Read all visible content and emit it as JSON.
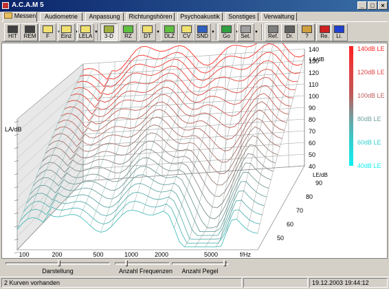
{
  "window": {
    "title": "A.C.A.M 5",
    "min": "_",
    "max": "□",
    "close": "×"
  },
  "tabs": [
    {
      "label": "Messen",
      "active": true
    },
    {
      "label": "Audiometrie"
    },
    {
      "label": "Anpassung"
    },
    {
      "label": "Richtungshören"
    },
    {
      "label": "Psychoakustik"
    },
    {
      "label": "Sonstiges"
    },
    {
      "label": "Verwaltung"
    }
  ],
  "toolbar": [
    {
      "label": "HIT",
      "icon": "hit-icon",
      "color": "#404040"
    },
    {
      "label": "REM",
      "icon": "rem-icon",
      "color": "#404040"
    },
    {
      "label": "F",
      "icon": "curve-icon",
      "color": "#f0e070"
    },
    {
      "label": "Einz",
      "icon": "curve-icon",
      "color": "#f0e070"
    },
    {
      "label": "LELA",
      "icon": "curve-icon",
      "color": "#f0e070"
    },
    {
      "label": "3-D",
      "icon": "3d-icon",
      "color": "#a0b040",
      "pressed": true
    },
    {
      "label": "RZ",
      "icon": "rz-icon",
      "color": "#60c040"
    },
    {
      "label": "DT",
      "icon": "dt-icon",
      "color": "#f0e070"
    },
    {
      "label": "DLZ",
      "icon": "dlz-icon",
      "color": "#60c040"
    },
    {
      "label": "CV",
      "icon": "cv-icon",
      "color": "#f0e070"
    },
    {
      "label": "SND",
      "icon": "snd-icon",
      "color": "#3060c0"
    },
    {
      "label": "Go",
      "icon": "go-icon",
      "color": "#30a040"
    },
    {
      "label": "Set.",
      "icon": "settings-icon",
      "color": "#a0a0a0"
    },
    {
      "label": "Ref.",
      "icon": "ref-icon",
      "color": "#808080"
    },
    {
      "label": "Dr.",
      "icon": "printer-icon",
      "color": "#606060"
    },
    {
      "label": "?",
      "icon": "help-icon",
      "color": "#d0a040"
    },
    {
      "label": "Re.",
      "icon": "right-ear-icon",
      "color": "#d02020"
    },
    {
      "label": "Li.",
      "icon": "left-ear-icon",
      "color": "#2040d0"
    }
  ],
  "chart": {
    "axis_left_label": "LA/dB",
    "axis_right_label": "LA/dB",
    "z_axis_label": "LE/dB",
    "x_axis_label": "f/Hz",
    "y_ticks": [
      "140",
      "130",
      "120",
      "110",
      "100",
      "90",
      "80",
      "70",
      "60",
      "50",
      "40"
    ],
    "x_ticks": [
      "100",
      "200",
      "500",
      "1000",
      "2000",
      "5000"
    ],
    "z_ticks": [
      "90",
      "80",
      "70",
      "60",
      "50"
    ],
    "legend": [
      "140dB LE",
      "120dB LE",
      "100dB LE",
      "80dB LE",
      "60dB LE",
      "40dB LE"
    ],
    "legend_colors": [
      "#ff2020",
      "#e04040",
      "#c05858",
      "#70a0a0",
      "#30d0d0",
      "#10f0f0"
    ]
  },
  "sliders": [
    {
      "label": "Darstellung",
      "value": 0.42
    },
    {
      "label": "Anzahl Frequenzen",
      "value": 0.1
    },
    {
      "label": "Anzahl Pegel",
      "value": 0.95
    }
  ],
  "status": {
    "left": "2 Kurven vorhanden",
    "middle": "",
    "right": "19.12.2003 19:44:12"
  }
}
